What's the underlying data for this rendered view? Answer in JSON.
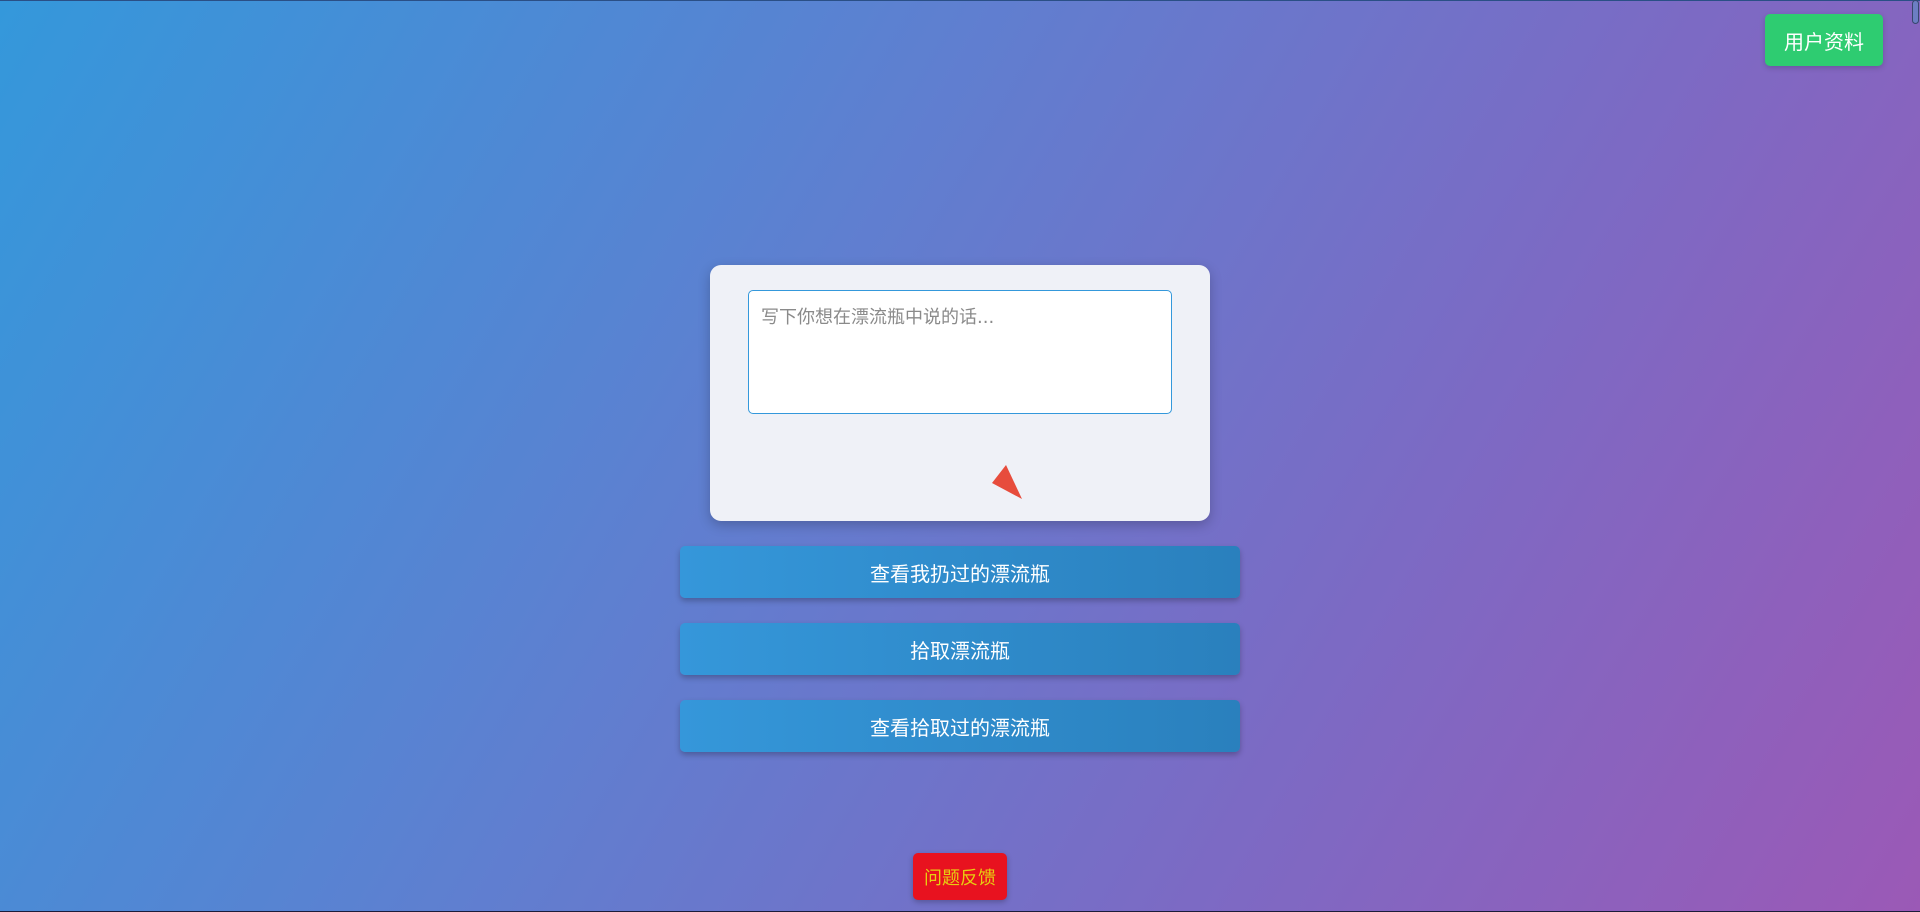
{
  "header": {
    "profile_label": "用户资料"
  },
  "composer": {
    "placeholder": "写下你想在漂流瓶中说的话...",
    "send_icon": "send-triangle-icon"
  },
  "actions": {
    "view_thrown_label": "查看我扔过的漂流瓶",
    "pick_label": "拾取漂流瓶",
    "view_picked_label": "查看拾取过的漂流瓶"
  },
  "footer": {
    "feedback_label": "问题反馈"
  },
  "colors": {
    "background_start": "#3498db",
    "background_end": "#9b59b6",
    "profile_button": "#2ecc71",
    "action_button": "#3498db",
    "send_icon": "#e74c3c",
    "feedback_button": "#e8121f",
    "feedback_text": "#e7ce11"
  }
}
